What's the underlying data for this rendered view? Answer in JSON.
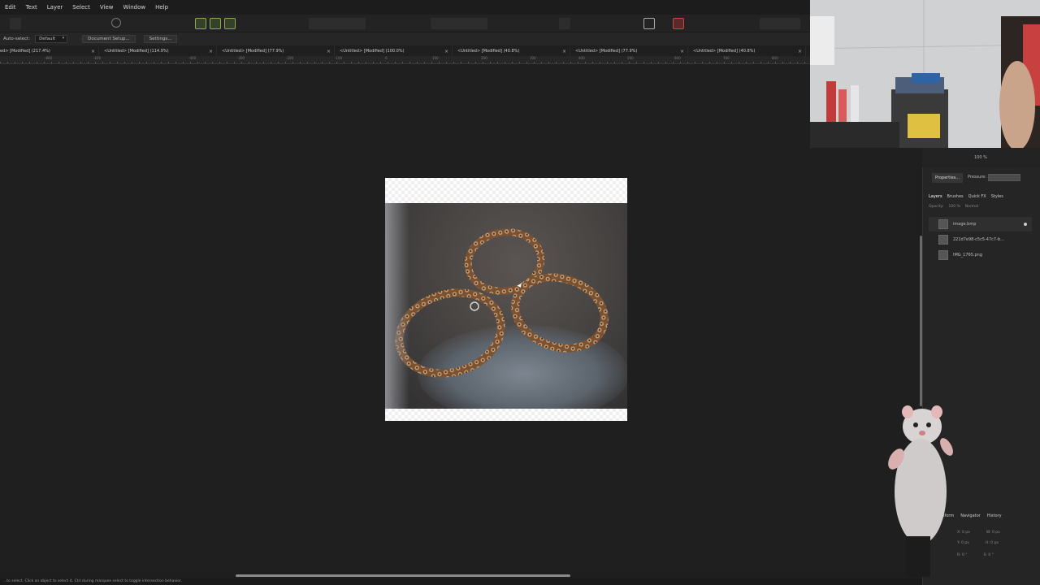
{
  "menu": [
    "Edit",
    "Text",
    "Layer",
    "Select",
    "View",
    "Window",
    "Help"
  ],
  "context_bar": {
    "auto_select_label": "Auto-select:",
    "auto_select_value": "Default",
    "document_setup": "Document Setup...",
    "settings": "Settings..."
  },
  "tabs": [
    {
      "label": "ed> [Modified] (217.4%)"
    },
    {
      "label": "<Untitled> [Modified] (114.9%)"
    },
    {
      "label": "<Untitled> [Modified] (77.9%)"
    },
    {
      "label": "<Untitled> [Modified] (100.0%)"
    },
    {
      "label": "<Untitled> [Modified] (40.8%)"
    },
    {
      "label": "<Untitled> [Modified] (77.9%)"
    },
    {
      "label": "<Untitled> [Modified] (40.8%)"
    }
  ],
  "tab_close": "×",
  "ruler_ticks": [
    "-800",
    "-600",
    "-400",
    "-300",
    "-200",
    "-100",
    "0",
    "100",
    "200",
    "300",
    "400",
    "500",
    "600",
    "700",
    "800"
  ],
  "right_panel": {
    "zoom": "100 %",
    "properties_tab": "Properties...",
    "pressure_label": "Pressure:",
    "panel_tabs": [
      "Layers",
      "Brushes",
      "Quick FX",
      "Styles"
    ],
    "opacity_label": "Opacity:",
    "opacity_value": "100 %",
    "blend_mode": "Normal",
    "layers": [
      {
        "name": "image.bmp"
      },
      {
        "name": "221d7e98-c5c5-47c7-b..."
      },
      {
        "name": "IMG_1765.png"
      }
    ],
    "bottom_tabs": [
      "sform",
      "Navigator",
      "History"
    ],
    "transform": {
      "x_label": "X:",
      "x_value": "0 px",
      "w_label": "W:",
      "w_value": "0 px",
      "y_label": "Y:",
      "y_value": "0 px",
      "h_label": "H:",
      "h_value": "0 px",
      "r_label": "R:",
      "r_value": "0 °",
      "s_label": "S:",
      "s_value": "0 °"
    }
  },
  "status_bar": "...to select. Click an object to select it. Ctrl during marquee select to toggle intersection behavior.",
  "colors": {
    "app_bg": "#1e1e1e",
    "accent_green": "#8faa48",
    "bracelet": "#a0704a"
  }
}
